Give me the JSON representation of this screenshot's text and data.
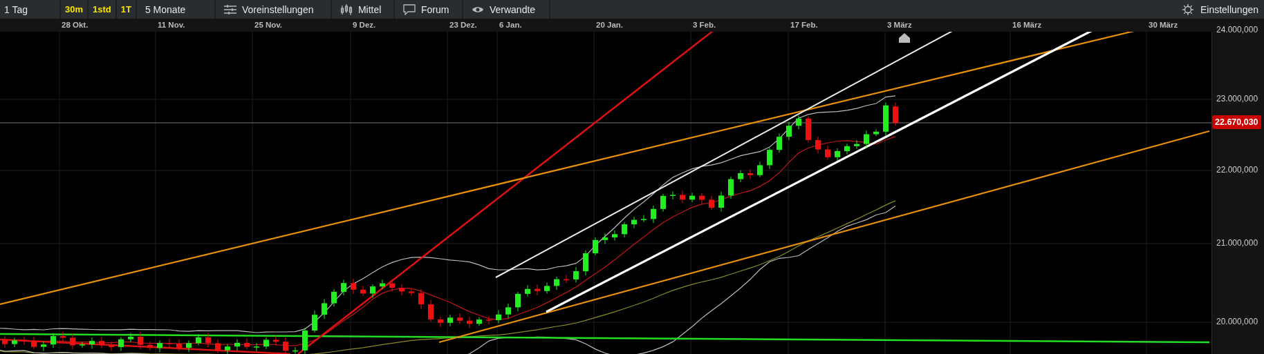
{
  "toolbar": {
    "items": [
      {
        "kind": "period",
        "label": "1 Tag"
      },
      {
        "kind": "interval",
        "label": "30m"
      },
      {
        "kind": "interval",
        "label": "1std"
      },
      {
        "kind": "interval",
        "label": "1T"
      },
      {
        "kind": "range",
        "label": "5 Monate"
      },
      {
        "kind": "presets",
        "label": "Voreinstellungen"
      },
      {
        "kind": "indicators",
        "label": "Mittel"
      },
      {
        "kind": "forum",
        "label": "Forum"
      },
      {
        "kind": "related",
        "label": "Verwandte"
      }
    ],
    "settings": {
      "label": "Einstellungen"
    }
  },
  "x_axis": {
    "labels": [
      "28 Okt.",
      "11 Nov.",
      "25 Nov.",
      "9 Dez.",
      "23 Dez.",
      "6 Jan.",
      "20 Jan.",
      "3 Feb.",
      "17 Feb.",
      "3 März",
      "16 März",
      "30 März"
    ]
  },
  "y_axis": {
    "ticks": [
      "24.000,000",
      "23.000,000",
      "22.000,000",
      "21.000,000",
      "20.000,000"
    ],
    "price_tag": "22.670,030"
  }
}
